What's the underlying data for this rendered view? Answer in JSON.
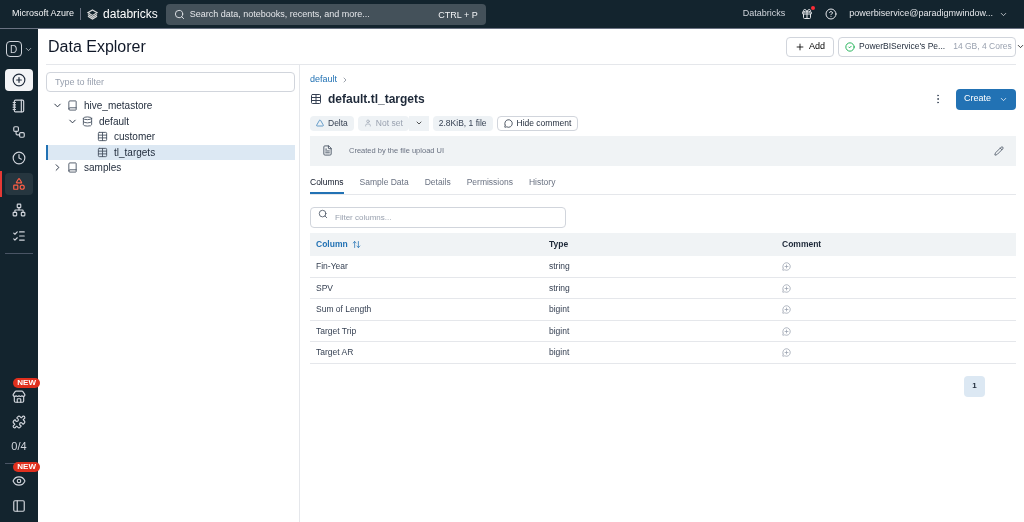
{
  "topbar": {
    "brand": "Microsoft Azure",
    "product": "databricks",
    "search": {
      "placeholder": "Search data, notebooks, recents, and more...",
      "shortcut": "CTRL + P"
    },
    "workspace": "Databricks",
    "gift_notification": true,
    "user": "powerbiservice@paradigmwindow..."
  },
  "rail": {
    "top": [
      {
        "kind": "workspace",
        "label": "D",
        "selected": false
      },
      {
        "kind": "new",
        "highlighted": true
      },
      {
        "kind": "notebook",
        "selected": false
      },
      {
        "kind": "workflow",
        "selected": false
      },
      {
        "kind": "recents",
        "selected": false
      },
      {
        "kind": "data",
        "selected": true
      },
      {
        "kind": "compute",
        "selected": false
      },
      {
        "kind": "tasks",
        "selected": false
      }
    ],
    "bottom": [
      {
        "kind": "marketplace",
        "badge": "NEW"
      },
      {
        "kind": "partners"
      },
      {
        "kind": "counter",
        "label": "0/4"
      },
      {
        "kind": "preview",
        "badge": "NEW"
      },
      {
        "kind": "panel"
      }
    ]
  },
  "page": {
    "title": "Data Explorer",
    "add_button": "Add",
    "cluster": {
      "name": "PowerBIService's Pe...",
      "specs": "14 GB, 4 Cores",
      "running": true
    }
  },
  "explorer": {
    "filter": {
      "placeholder": "Type to filter"
    },
    "tree": [
      {
        "label": "hive_metastore",
        "kind": "catalog",
        "expanded": true,
        "selected": false,
        "children": [
          {
            "label": "default",
            "kind": "schema",
            "expanded": true,
            "selected": false,
            "children": [
              {
                "label": "customer",
                "kind": "table",
                "selected": false
              },
              {
                "label": "tl_targets",
                "kind": "table",
                "selected": true
              }
            ]
          }
        ]
      },
      {
        "label": "samples",
        "kind": "catalog",
        "expanded": false,
        "selected": false
      }
    ]
  },
  "detail": {
    "breadcrumb": "default",
    "title": "default.tl_targets",
    "create_button": "Create",
    "tags": [
      {
        "kind": "format",
        "label": "Delta"
      },
      {
        "kind": "owner",
        "label": "Not set",
        "disabled": true
      },
      {
        "kind": "size",
        "label": "2.8KiB, 1 file"
      },
      {
        "kind": "comment",
        "label": "Hide comment"
      }
    ],
    "comment": "Created by the file upload UI",
    "tabs": [
      {
        "label": "Columns",
        "selected": true
      },
      {
        "label": "Sample Data",
        "selected": false
      },
      {
        "label": "Details",
        "selected": false
      },
      {
        "label": "Permissions",
        "selected": false
      },
      {
        "label": "History",
        "selected": false
      }
    ],
    "column_filter": {
      "placeholder": "Filter columns..."
    },
    "table": {
      "columns": [
        "Column",
        "Type",
        "Comment"
      ],
      "rows": [
        {
          "name": "Fin-Year",
          "type": "string"
        },
        {
          "name": "SPV",
          "type": "string"
        },
        {
          "name": "Sum of Length",
          "type": "bigint"
        },
        {
          "name": "Target Trip",
          "type": "bigint"
        },
        {
          "name": "Target AR",
          "type": "bigint"
        }
      ]
    },
    "pages": [
      {
        "label": "1",
        "selected": true
      }
    ]
  }
}
